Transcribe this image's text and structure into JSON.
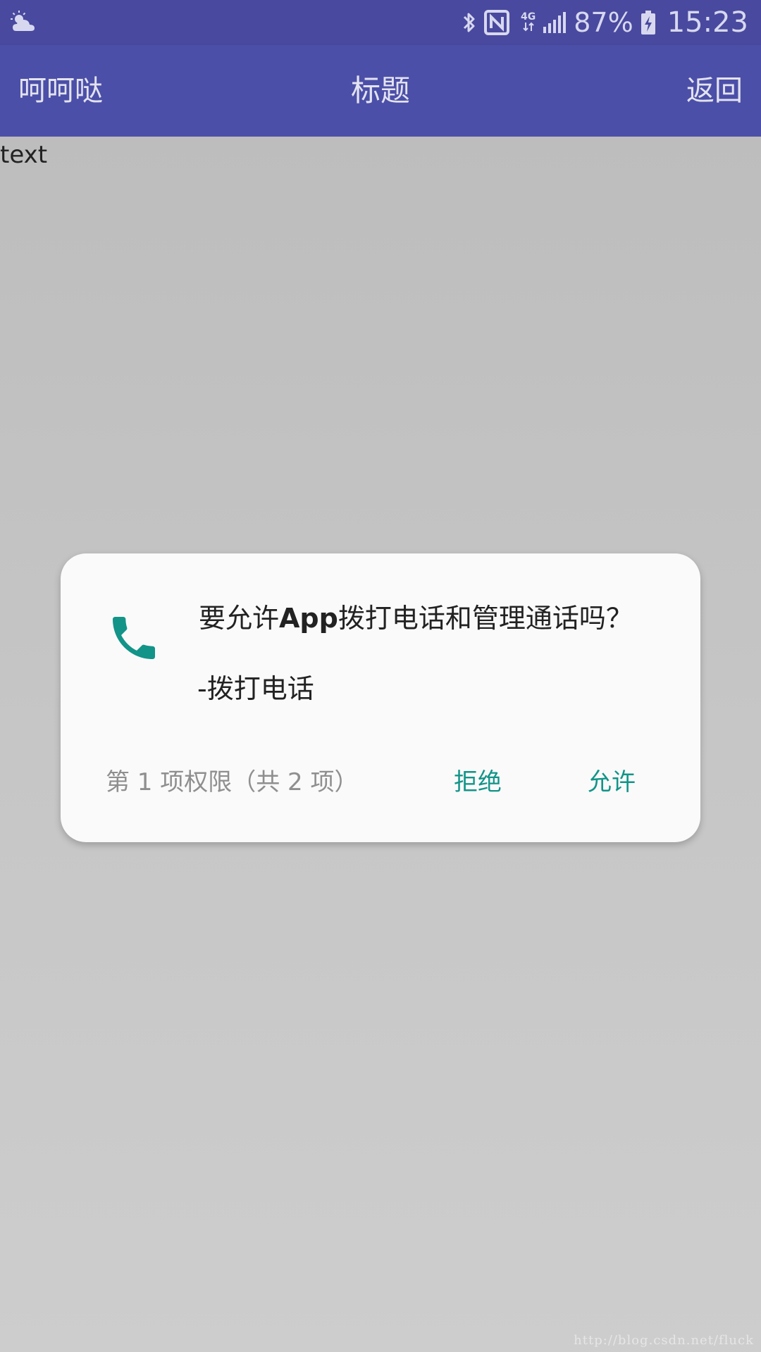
{
  "status_bar": {
    "weather_icon": "partly-cloudy-icon",
    "bluetooth_icon": "bluetooth-icon",
    "nfc_icon": "nfc-icon",
    "network_label": "4G",
    "signal_icon": "signal-icon",
    "battery_percent": "87%",
    "battery_icon": "battery-charging-icon",
    "time": "15:23"
  },
  "app_bar": {
    "left_label": "呵呵哒",
    "title": "标题",
    "back_label": "返回"
  },
  "content": {
    "text": "text"
  },
  "dialog": {
    "icon": "phone-icon",
    "question_prefix": "要允许",
    "question_app": "App",
    "question_suffix": "拨打电话和管理通话吗？",
    "detail": "-拨打电话",
    "counter": "第 1 项权限（共 2 项）",
    "deny_label": "拒绝",
    "allow_label": "允许"
  },
  "watermark": "http://blog.csdn.net/fluck",
  "colors": {
    "status_bar": "#49499f",
    "app_bar": "#4c4fa8",
    "accent": "#129488",
    "dialog_bg": "#fafafa",
    "scrim": "#c6c6c6"
  }
}
